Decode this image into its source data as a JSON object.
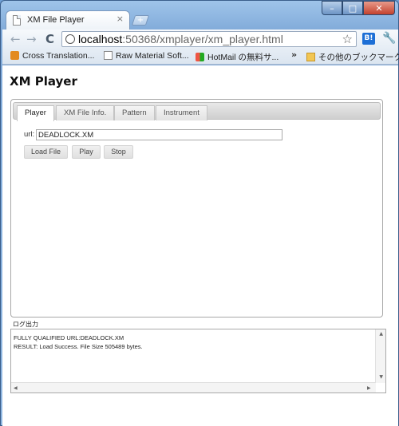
{
  "browser": {
    "tab_title": "XM File Player",
    "tab_close": "×",
    "new_tab": "+",
    "url_host": "localhost",
    "url_path": ":50368/xmplayer/xm_player.html",
    "window_buttons": {
      "minimize": "–",
      "maximize": "□",
      "close": "✕"
    },
    "bookmarks": [
      {
        "label": "Cross Translation...",
        "icon": "cross-translation-icon"
      },
      {
        "label": "Raw Material Soft...",
        "icon": "page-icon"
      },
      {
        "label": "HotMail の無料サ...",
        "icon": "windows-icon"
      },
      {
        "label": "その他のブックマーク",
        "icon": "folder-icon"
      }
    ],
    "bookmarks_overflow": "»",
    "extension_b": "B!"
  },
  "page": {
    "title": "XM Player",
    "tabs": [
      {
        "label": "Player"
      },
      {
        "label": "XM File Info."
      },
      {
        "label": "Pattern"
      },
      {
        "label": "Instrument"
      }
    ],
    "url_label": "url:",
    "url_value": "DEADLOCK.XM",
    "buttons": {
      "load": "Load File",
      "play": "Play",
      "stop": "Stop"
    },
    "log": {
      "label": "ログ出力",
      "lines": [
        "FULLY QUALIFIED URL:DEADLOCK.XM",
        "RESULT: Load Success. File Size 505489 bytes."
      ]
    }
  }
}
